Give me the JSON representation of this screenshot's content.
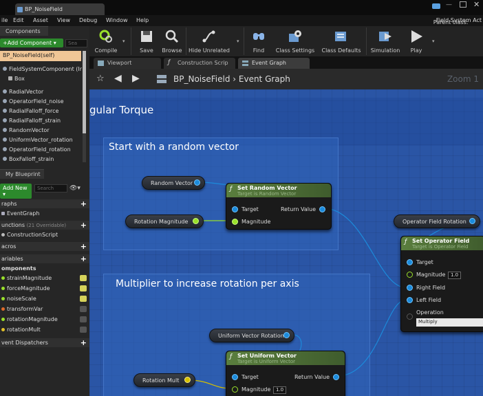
{
  "app": {
    "document_tab": "BP_NoiseField",
    "parent_class_label": "Parent class:",
    "parent_class_value": "Field System Act"
  },
  "menu": [
    "ile",
    "Edit",
    "Asset",
    "View",
    "Debug",
    "Window",
    "Help"
  ],
  "components_panel": {
    "tab": "Components",
    "add_button": "+Add Component ▾",
    "search_placeholder": "Sea",
    "self_item": "BP_NoiseField(self)",
    "items": [
      "FieldSystemComponent (Ir",
      "Box",
      "RadialVector",
      "OperatorField_noise",
      "RadialFalloff_force",
      "RadialFalloff_strain",
      "RandomVector",
      "UniformVector_rotation",
      "OperatorField_rotation",
      "BoxFalloff_strain"
    ]
  },
  "blueprint_panel": {
    "tab": "My Blueprint",
    "add_button": "Add New ▾",
    "search_placeholder": "Search",
    "graphs_header": "raphs",
    "event_graph": "EventGraph",
    "functions_header": "unctions",
    "functions_count": "(21 Overridable)",
    "construction_script": "ConstructionScript",
    "macros_header": "acros",
    "variables_header": "ariables",
    "components_header": "omponents",
    "variables": [
      {
        "name": "strainMagnitude",
        "color": "#9ae02a"
      },
      {
        "name": "forceMagnitude",
        "color": "#9ae02a"
      },
      {
        "name": "noiseScale",
        "color": "#9ae02a"
      },
      {
        "name": "transformVar",
        "color": "#e06a2a"
      },
      {
        "name": "rotationMagnitude",
        "color": "#9ae02a"
      },
      {
        "name": "rotationMult",
        "color": "#e0c02a"
      }
    ],
    "dispatchers_header": "vent Dispatchers"
  },
  "toolbar": {
    "compile": "Compile",
    "save": "Save",
    "browse": "Browse",
    "hide_unrelated": "Hide Unrelated",
    "find": "Find",
    "class_settings": "Class Settings",
    "class_defaults": "Class Defaults",
    "simulation": "Simulation",
    "play": "Play"
  },
  "editor_tabs": {
    "viewport": "Viewport",
    "construction": "Construction Scrip",
    "event_graph": "Event Graph"
  },
  "breadcrumb": {
    "text": "BP_NoiseField  ›  Event Graph",
    "zoom": "Zoom 1"
  },
  "graph": {
    "heading": "gular Torque",
    "comment1": "Start with a random vector",
    "comment2": "Multiplier to increase rotation per axis",
    "random_vector_pill": "Random Vector",
    "rotation_magnitude_pill": "Rotation Magnitude",
    "set_random_vector": {
      "title": "Set Random Vector",
      "subtitle": "Target is Random Vector",
      "target": "Target",
      "return_value": "Return Value",
      "magnitude": "Magnitude"
    },
    "operator_field_rotation_pill": "Operator Field Rotation",
    "set_operator_field": {
      "title": "Set Operator Field",
      "subtitle": "Target is Operator Field",
      "target": "Target",
      "magnitude": "Magnitude",
      "magnitude_value": "1.0",
      "right_field": "Right Field",
      "left_field": "Left Field",
      "operation": "Operation",
      "operation_value": "Multiply"
    },
    "uniform_vector_rotation_pill": "Uniform Vector Rotation",
    "rotation_mult_pill": "Rotation Mult",
    "set_uniform_vector": {
      "title": "Set Uniform Vector",
      "subtitle": "Target is Uniform Vector",
      "target": "Target",
      "return_value": "Return Value",
      "magnitude": "Magnitude",
      "magnitude_value": "1.0"
    }
  }
}
